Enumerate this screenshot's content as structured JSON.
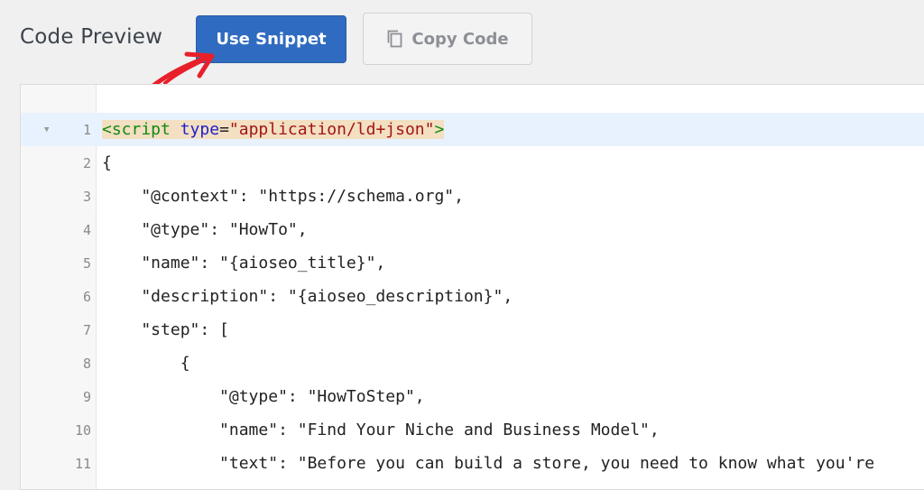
{
  "header": {
    "title": "Code Preview",
    "use_snippet_label": "Use Snippet",
    "copy_code_label": "Copy Code",
    "copy_icon": "copy-icon",
    "accent_color": "#2f6bc0",
    "annotation_arrow_color": "#e8202a"
  },
  "editor": {
    "active_line": 1,
    "lines": [
      {
        "num": "1",
        "parts": [
          {
            "t": "<script ",
            "c": "t-tag"
          },
          {
            "t": "type",
            "c": "t-attr"
          },
          {
            "t": "=",
            "c": ""
          },
          {
            "t": "\"application/ld+json\"",
            "c": "t-str"
          },
          {
            "t": ">",
            "c": "t-tag"
          }
        ]
      },
      {
        "num": "2",
        "text": "{"
      },
      {
        "num": "3",
        "text": "    \"@context\": \"https://schema.org\","
      },
      {
        "num": "4",
        "text": "    \"@type\": \"HowTo\","
      },
      {
        "num": "5",
        "text": "    \"name\": \"{aioseo_title}\","
      },
      {
        "num": "6",
        "text": "    \"description\": \"{aioseo_description}\","
      },
      {
        "num": "7",
        "text": "    \"step\": ["
      },
      {
        "num": "8",
        "text": "        {"
      },
      {
        "num": "9",
        "text": "            \"@type\": \"HowToStep\","
      },
      {
        "num": "10",
        "text": "            \"name\": \"Find Your Niche and Business Model\","
      },
      {
        "num": "11",
        "text": "            \"text\": \"Before you can build a store, you need to know what you're"
      }
    ]
  }
}
